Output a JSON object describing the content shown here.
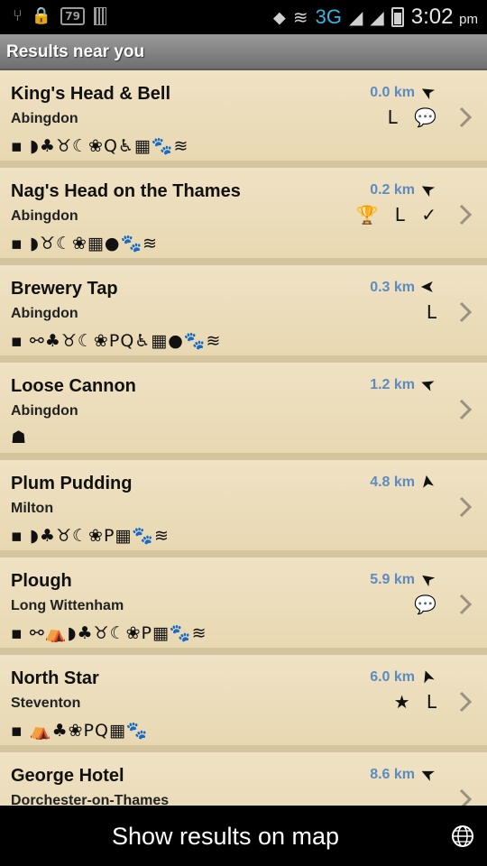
{
  "status_bar": {
    "left_icons": [
      "usb-icon",
      "lock-icon",
      "notification-count-icon",
      "sd-card-icon"
    ],
    "notification_count": "79",
    "network": "3G",
    "time": "3:02",
    "ampm": "pm"
  },
  "header": {
    "title": "Results near you"
  },
  "results": [
    {
      "name": "King's Head & Bell",
      "town": "Abingdon",
      "distance": "0.0 km",
      "direction": "➤",
      "badges": "L 💬",
      "amenities": "▪ ◗♣♉☾❀Q♿▦🐾≋"
    },
    {
      "name": "Nag's Head on the Thames",
      "town": "Abingdon",
      "distance": "0.2 km",
      "direction": "➤",
      "badges": "🏆 L ✓",
      "amenities": "▪ ◗♉☾❀▦●🐾≋"
    },
    {
      "name": "Brewery Tap",
      "town": "Abingdon",
      "distance": "0.3 km",
      "direction": "➤",
      "badges": "L",
      "amenities": "▪ ⚯♣♉☾❀PQ♿▦●🐾≋"
    },
    {
      "name": "Loose Cannon",
      "town": "Abingdon",
      "distance": "1.2 km",
      "direction": "➤",
      "badges": "",
      "amenities": "☗"
    },
    {
      "name": "Plum Pudding",
      "town": "Milton",
      "distance": "4.8 km",
      "direction": "➤",
      "badges": "",
      "amenities": "▪ ◗♣♉☾❀P▦🐾≋"
    },
    {
      "name": "Plough",
      "town": "Long Wittenham",
      "distance": "5.9 km",
      "direction": "➤",
      "badges": "💬",
      "amenities": "▪ ⚯⛺◗♣♉☾❀P▦🐾≋"
    },
    {
      "name": "North Star",
      "town": "Steventon",
      "distance": "6.0 km",
      "direction": "➤",
      "badges": "★ L",
      "amenities": "▪ ⛺♣❀PQ▦🐾"
    },
    {
      "name": "George Hotel",
      "town": "Dorchester-on-Thames",
      "distance": "8.6 km",
      "direction": "➤",
      "badges": "",
      "amenities": ""
    }
  ],
  "bottom_bar": {
    "label": "Show results on map"
  }
}
